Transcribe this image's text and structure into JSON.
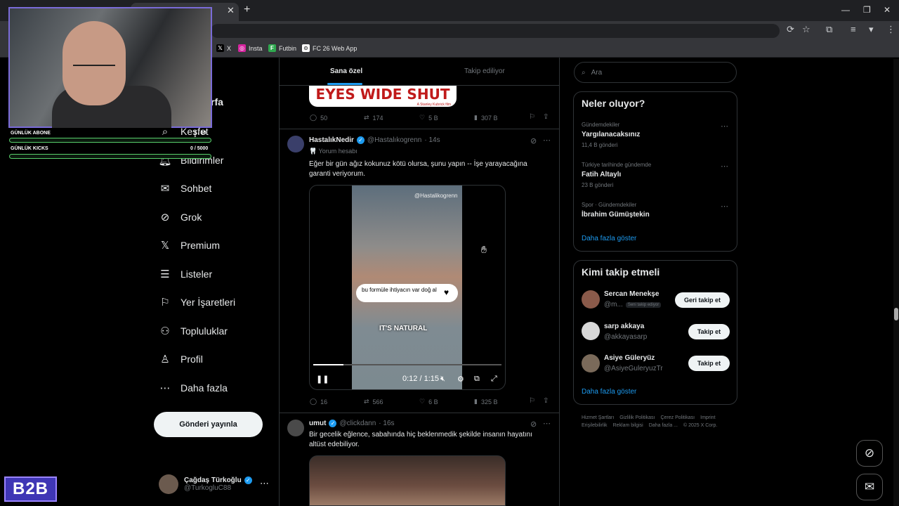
{
  "browser": {
    "close_glyph": "✕",
    "new_tab_glyph": "+",
    "window_controls": [
      "—",
      "❐",
      "✕"
    ],
    "toolbar_icons": [
      "⟳",
      "☆",
      "⧉",
      "≡",
      "▾",
      "⋮"
    ],
    "bookmarks": [
      {
        "label": "X",
        "icon": "x-logo",
        "color": "#000000",
        "glyph": "𝕏"
      },
      {
        "label": "Insta",
        "icon": "instagram-icon",
        "color": "#d6249f",
        "glyph": "◎"
      },
      {
        "label": "Futbin",
        "icon": "futbin-icon",
        "color": "#2fa84f",
        "glyph": "F"
      },
      {
        "label": "FC 26 Web App",
        "icon": "fc-webapp-icon",
        "color": "#ffffff",
        "glyph": "⊙"
      }
    ]
  },
  "overlay": {
    "stats": [
      {
        "label": "GÜNLÜK ABONE",
        "value": "3 / 10"
      },
      {
        "label": "GÜNLÜK KICKS",
        "value": "0 / 5000"
      }
    ],
    "logo_text": "B2B"
  },
  "nav": {
    "partial_header": "rfa",
    "items": [
      {
        "label": "Keşfet",
        "icon": "search-icon",
        "glyph": "⌕"
      },
      {
        "label": "Bildirimler",
        "icon": "bell-icon",
        "glyph": "🔔︎"
      },
      {
        "label": "Sohbet",
        "icon": "mail-icon",
        "glyph": "✉"
      },
      {
        "label": "Grok",
        "icon": "grok-icon",
        "glyph": "⊘"
      },
      {
        "label": "Premium",
        "icon": "x-logo-icon",
        "glyph": "𝕏"
      },
      {
        "label": "Listeler",
        "icon": "list-icon",
        "glyph": "☰"
      },
      {
        "label": "Yer İşaretleri",
        "icon": "bookmark-icon",
        "glyph": "⚐"
      },
      {
        "label": "Topluluklar",
        "icon": "people-icon",
        "glyph": "⚇"
      },
      {
        "label": "Profil",
        "icon": "person-icon",
        "glyph": "♙"
      },
      {
        "label": "Daha fazla",
        "icon": "more-circle-icon",
        "glyph": "⋯"
      }
    ],
    "post_button": "Gönderi yayınla",
    "account": {
      "name": "Çağdaş Türkoğlu",
      "handle": "@TurkogluC88",
      "more": "⋯"
    }
  },
  "feed": {
    "tabs": [
      "Sana özel",
      "Takip ediliyor"
    ],
    "post1": {
      "image_title": "EYES WIDE SHUT",
      "image_sub": "A Stanley Kubrick film",
      "replies": "50",
      "reposts": "174",
      "likes": "5 B",
      "views": "307 B"
    },
    "post2": {
      "name": "HastalıkNedir",
      "handle": "@Hastalıkogrenn",
      "time": "· 14s",
      "subline": "🦷 Yorum hesabı",
      "text": "Eğer bir gün ağız kokunuz kötü olursa, şunu yapın -- İşe yarayacağına garanti veriyorum.",
      "video": {
        "watermark": "@Hastalikogrenn",
        "caption": "bu formüle ihtiyacın var doğ al",
        "overlay_text": "IT'S NATURAL",
        "time": "0:12 / 1:15",
        "progress": 0.16
      },
      "replies": "16",
      "reposts": "566",
      "likes": "6 B",
      "views": "325 B"
    },
    "post3": {
      "name": "umut",
      "handle": "@clickdann",
      "time": "· 16s",
      "text": "Bir gecelik eğlence, sabahında hiç beklenmedik şekilde insanın hayatını altüst edebiliyor."
    }
  },
  "sidebar": {
    "search_placeholder": "Ara",
    "trends_title": "Neler oluyor?",
    "trends": [
      {
        "meta": "Gündemdekiler",
        "name": "Yargılanacaksınız",
        "count": "11,4 B gönderi"
      },
      {
        "meta": "Türkiye tarihinde gündemde",
        "name": "Fatih Altaylı",
        "count": "23 B gönderi"
      },
      {
        "meta": "Spor · Gündemdekiler",
        "name": "İbrahim Gümüştekin",
        "count": ""
      }
    ],
    "show_more": "Daha fazla göster",
    "follow_title": "Kimi takip etmeli",
    "follows": [
      {
        "name": "Sercan Menekşe",
        "handle": "@m...",
        "badge": "Seni takip ediyor",
        "button": "Geri takip et"
      },
      {
        "name": "sarp akkaya",
        "handle": "@akkayasarp",
        "badge": "",
        "button": "Takip et"
      },
      {
        "name": "Asiye Güleryüz",
        "handle": "@AsiyeGuleryuzTr",
        "badge": "",
        "button": "Takip et"
      }
    ],
    "footer": [
      "Hizmet Şartları",
      "Gizlilik Politikası",
      "Çerez Politikası",
      "Imprint",
      "Erişilebilirlik",
      "Reklam bilgisi",
      "Daha fazla ...",
      "© 2025 X Corp."
    ]
  }
}
